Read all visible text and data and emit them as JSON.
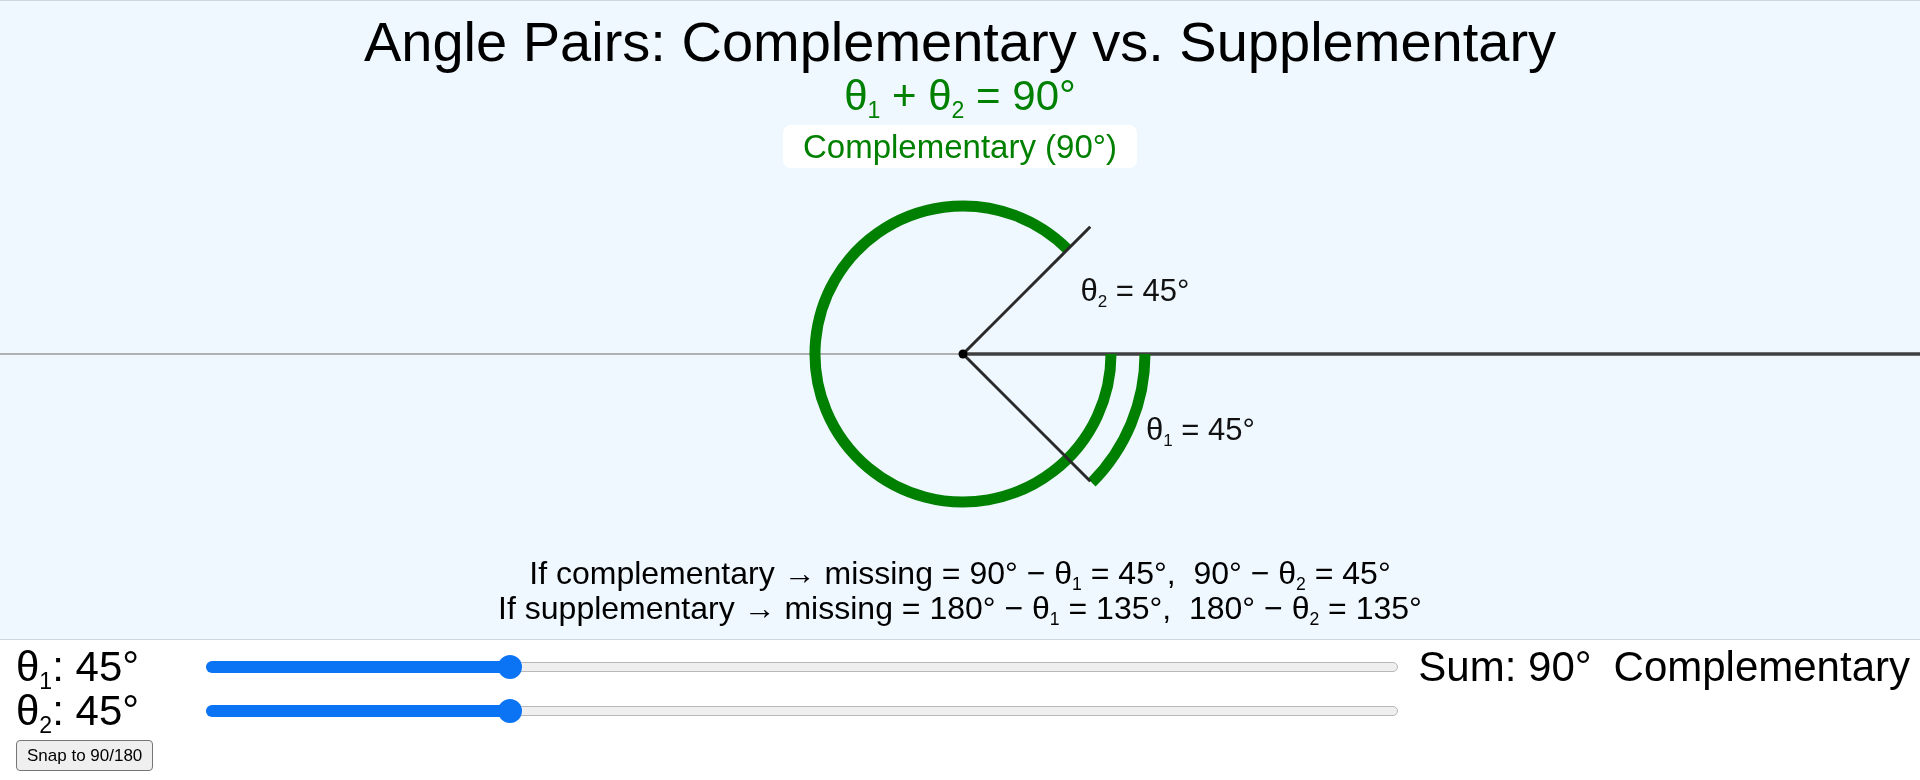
{
  "title": "Angle Pairs: Complementary vs. Supplementary",
  "diagram": {
    "kind": "complementary",
    "equation": "θ$_{1}$ + θ$_{2}$ = 90°",
    "badge": "Complementary (90°)",
    "angle_labels": [
      {
        "kind": "upper",
        "text": "θ$_{2}$ = 45°"
      },
      {
        "kind": "lower",
        "text": "θ$_{1}$ = 45°"
      }
    ]
  },
  "notes": [
    "If complementary → missing = 90° − θ$_{1}$ = 45°,  90° − θ$_{2}$ = 45°",
    "If supplementary → missing = 180° − θ$_{1}$ = 135°,  180° − θ$_{2}$ = 135°"
  ],
  "controls": {
    "sliders": [
      {
        "label": "θ$_{1}$: 45°",
        "level": 0.25
      },
      {
        "label": "θ$_{2}$: 45°",
        "level": 0.25
      }
    ],
    "sum": "Sum: 90°",
    "classification": "Complementary",
    "button": "Snap to 90/180"
  }
}
